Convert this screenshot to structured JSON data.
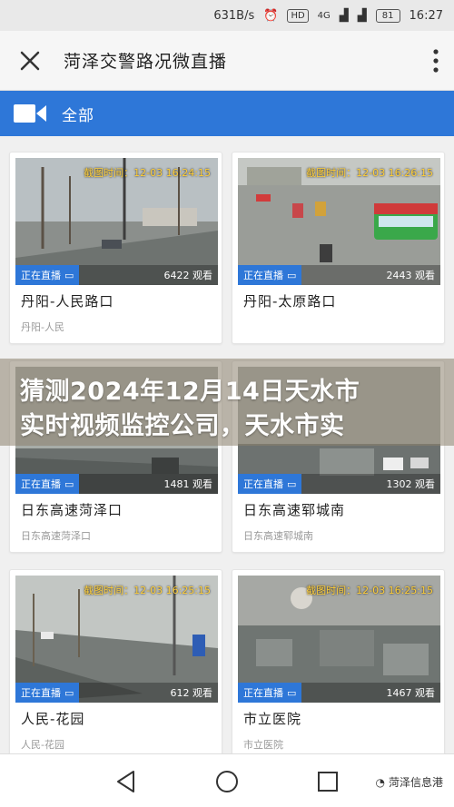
{
  "status_bar": {
    "net_speed": "631B/s",
    "hd": "HD",
    "signal": "4G",
    "battery": "81",
    "time": "16:27"
  },
  "app_bar": {
    "title": "菏泽交警路况微直播"
  },
  "category": {
    "label": "全部"
  },
  "cards": [
    {
      "timestamp": "截图时间：12-03 16:24:15",
      "live": "正在直播",
      "viewers": "6422 观看",
      "name": "丹阳-人民路口",
      "sub": "丹阳-人民"
    },
    {
      "timestamp": "截图时间：12-03 16:26:15",
      "live": "正在直播",
      "viewers": "2443 观看",
      "name": "丹阳-太原路口",
      "sub": ""
    },
    {
      "timestamp": "",
      "live": "正在直播",
      "viewers": "1481 观看",
      "name": "日东高速菏泽口",
      "sub": "日东高速菏泽口"
    },
    {
      "timestamp": "",
      "live": "正在直播",
      "viewers": "1302 观看",
      "name": "日东高速郓城南",
      "sub": "日东高速郓城南"
    },
    {
      "timestamp": "截图时间：12-03 16:25:15",
      "live": "正在直播",
      "viewers": "612 观看",
      "name": "人民-花园",
      "sub": "人民-花园"
    },
    {
      "timestamp": "截图时间：12-03 16:25:15",
      "live": "正在直播",
      "viewers": "1467 观看",
      "name": "市立医院",
      "sub": "市立医院"
    }
  ],
  "overlay": {
    "line1": "猜测2024年12月14日天水市",
    "line2": "实时视频监控公司，天水市实"
  },
  "watermark": {
    "text": "菏泽信息港"
  },
  "colors": {
    "accent": "#2e77d8",
    "timestamp": "#ffcf3a"
  }
}
